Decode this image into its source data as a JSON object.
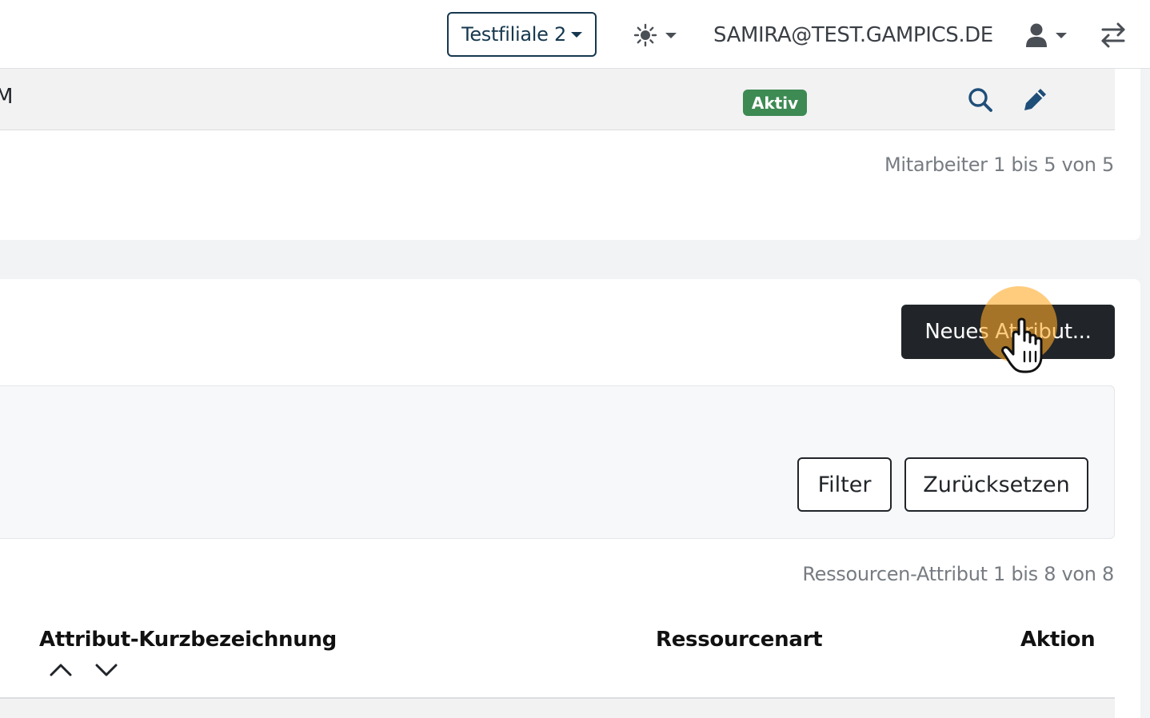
{
  "header": {
    "branch_label": "Testfiliale 2",
    "user_email": "SAMIRA@TEST.GAMPICS.DE",
    "icons": {
      "theme": "sun-icon",
      "user": "user-icon",
      "switch": "arrows-swap-icon"
    }
  },
  "staff_table": {
    "row_text_partial": "M",
    "status_badge": "Aktiv",
    "status_color": "#3d8a53",
    "row_actions": [
      "search-icon",
      "pencil-icon"
    ],
    "count_text": "Mitarbeiter 1 bis 5 von 5"
  },
  "attributes": {
    "new_button_label": "Neues Attribut...",
    "filter_button_label": "Filter",
    "reset_button_label": "Zurücksetzen",
    "count_text": "Ressourcen-Attribut 1 bis 8 von 8",
    "columns": [
      "Attribut-Kurzbezeichnung",
      "Ressourcenart",
      "Aktion"
    ]
  },
  "colors": {
    "accent_dark": "#212529",
    "navy": "#16384f",
    "icon_blue": "#1f4e79",
    "cursor_highlight": "#ffaa28"
  }
}
